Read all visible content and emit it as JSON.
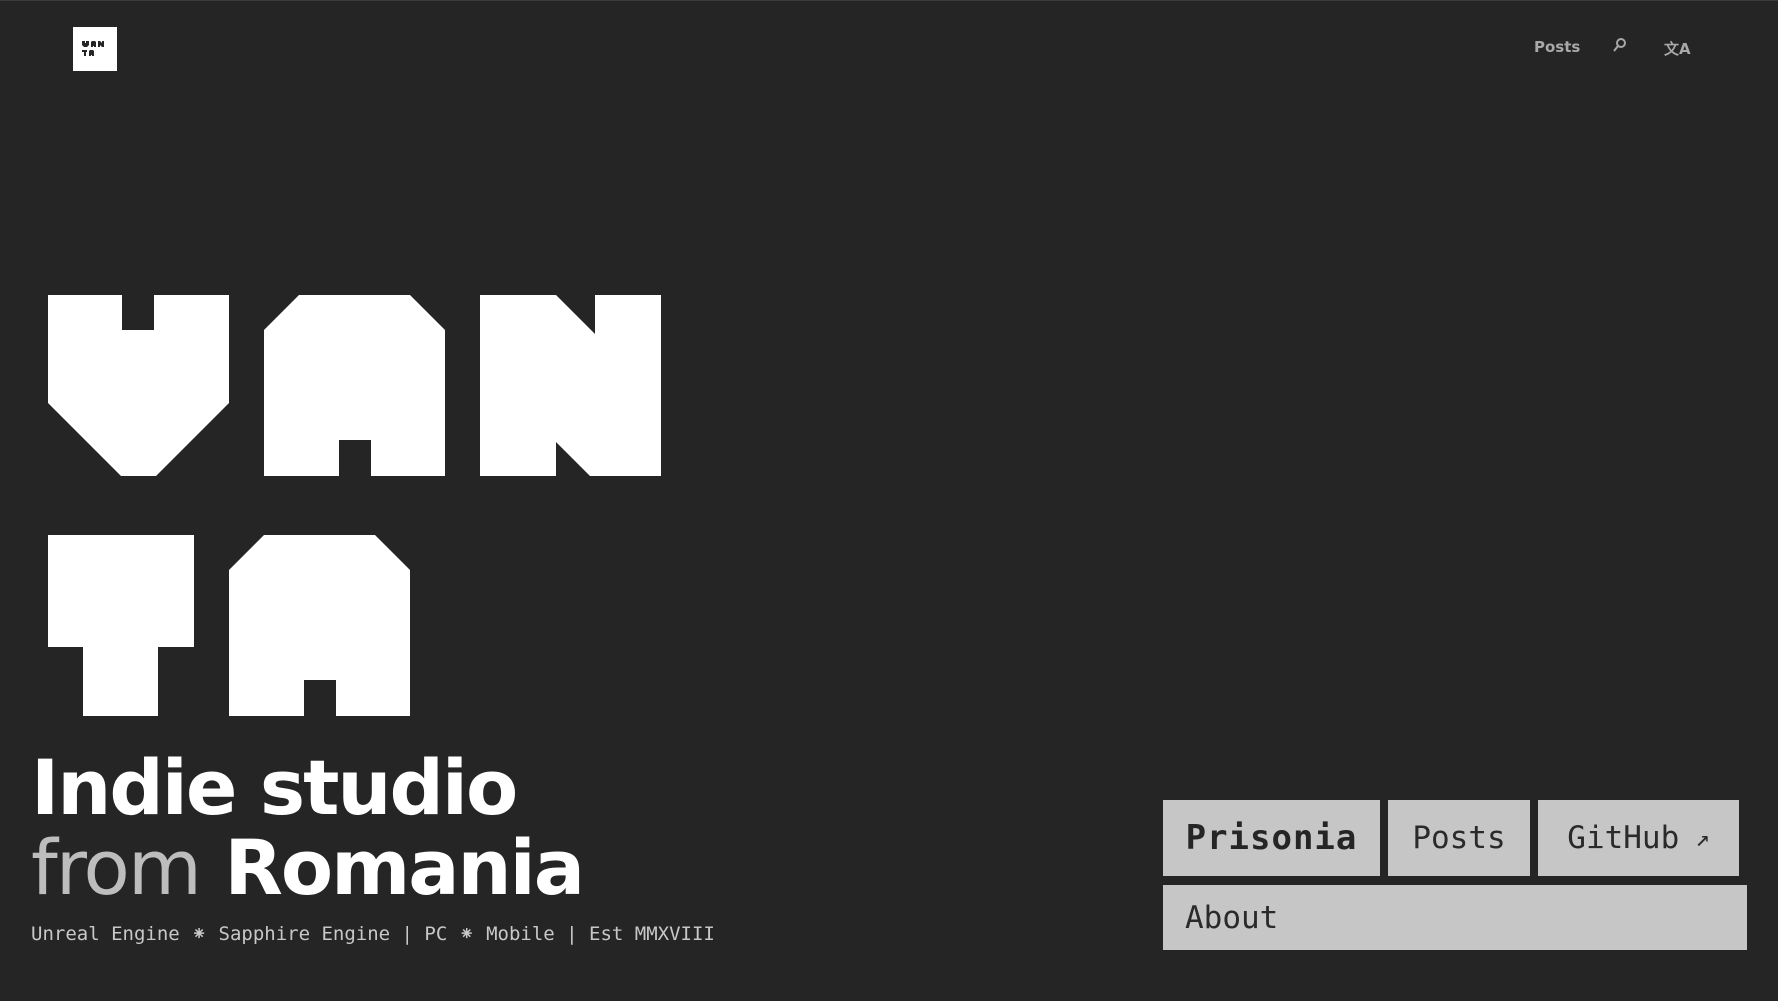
{
  "header": {
    "logo_alt": "VANTA",
    "nav": {
      "posts_label": "Posts",
      "search_icon": "search-icon",
      "language_label": "文A"
    }
  },
  "hero": {
    "wordmark": "VANTA",
    "headline_line1": "Indie studio",
    "headline_from": "from",
    "headline_place": "Romania",
    "tagline": "Unreal Engine ⁕ Sapphire Engine | PC ⁕ Mobile | Est MMXVIII"
  },
  "links": {
    "prisonia_label": "Prisonia",
    "posts_label": "Posts",
    "github_label": "GitHub",
    "github_arrow": "↗",
    "about_label": "About"
  },
  "colors": {
    "background": "#252525",
    "foreground": "#ffffff",
    "button_bg": "#c6c6c6",
    "button_text": "#2a2a2a",
    "muted_text": "#bdbdbd"
  }
}
